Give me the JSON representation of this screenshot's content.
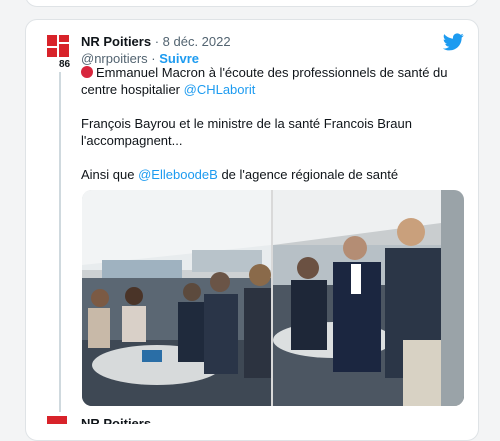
{
  "tweet": {
    "author_name": "NR Poitiers",
    "date": "8 déc. 2022",
    "handle": "@nrpoitiers",
    "follow_label": "Suivre",
    "logo_number": "86",
    "line1_text": "Emmanuel Macron à l'écoute des professionnels de santé du centre hospitalier",
    "line1_mention": "@CHLaborit",
    "line2_text": "François Bayrou et le ministre de la santé Francois Braun l'accompagnent...",
    "line3_prefix": "Ainsi que",
    "line3_mention": "@ElleboodeB",
    "line3_suffix": "de l'agence régionale de santé"
  },
  "next_tweet": {
    "author_name": "NR Poitiers"
  },
  "colors": {
    "accent": "#1d9bf0",
    "brand_red": "#d8232a",
    "status_dot": "#d7263d"
  },
  "icons": [
    "twitter-bird-icon",
    "red-circle-emoji-icon",
    "nr-logo-icon"
  ]
}
